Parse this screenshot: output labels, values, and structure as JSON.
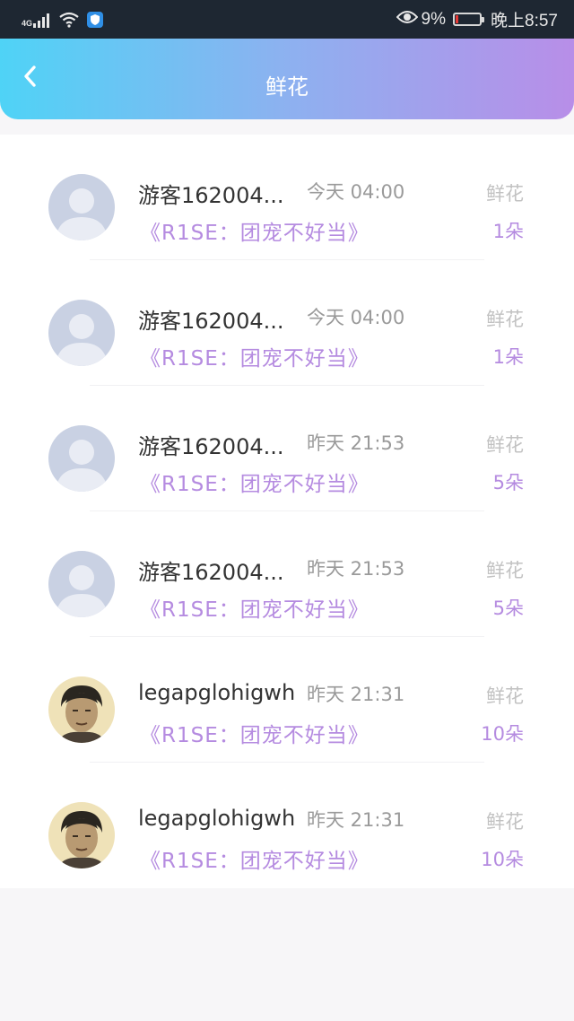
{
  "status_bar": {
    "network": "4G",
    "battery": "9%",
    "battery_level": 0.09,
    "time": "晚上8:57"
  },
  "header": {
    "title": "鲜花"
  },
  "items": [
    {
      "name": "游客162004...",
      "time": "今天 04:00",
      "label": "鲜花",
      "book": "《R1SE：团宠不好当》",
      "count": "1朵",
      "avatar": "default-avatar"
    },
    {
      "name": "游客162004...",
      "time": "今天 04:00",
      "label": "鲜花",
      "book": "《R1SE：团宠不好当》",
      "count": "1朵",
      "avatar": "default-avatar"
    },
    {
      "name": "游客162004...",
      "time": "昨天 21:53",
      "label": "鲜花",
      "book": "《R1SE：团宠不好当》",
      "count": "5朵",
      "avatar": "default-avatar"
    },
    {
      "name": "游客162004...",
      "time": "昨天 21:53",
      "label": "鲜花",
      "book": "《R1SE：团宠不好当》",
      "count": "5朵",
      "avatar": "default-avatar"
    },
    {
      "name": "legapglohigwh",
      "time": "昨天 21:31",
      "label": "鲜花",
      "book": "《R1SE：团宠不好当》",
      "count": "10朵",
      "avatar": "photo-avatar"
    },
    {
      "name": "legapglohigwh",
      "time": "昨天 21:31",
      "label": "鲜花",
      "book": "《R1SE：团宠不好当》",
      "count": "10朵",
      "avatar": "photo-avatar"
    }
  ]
}
